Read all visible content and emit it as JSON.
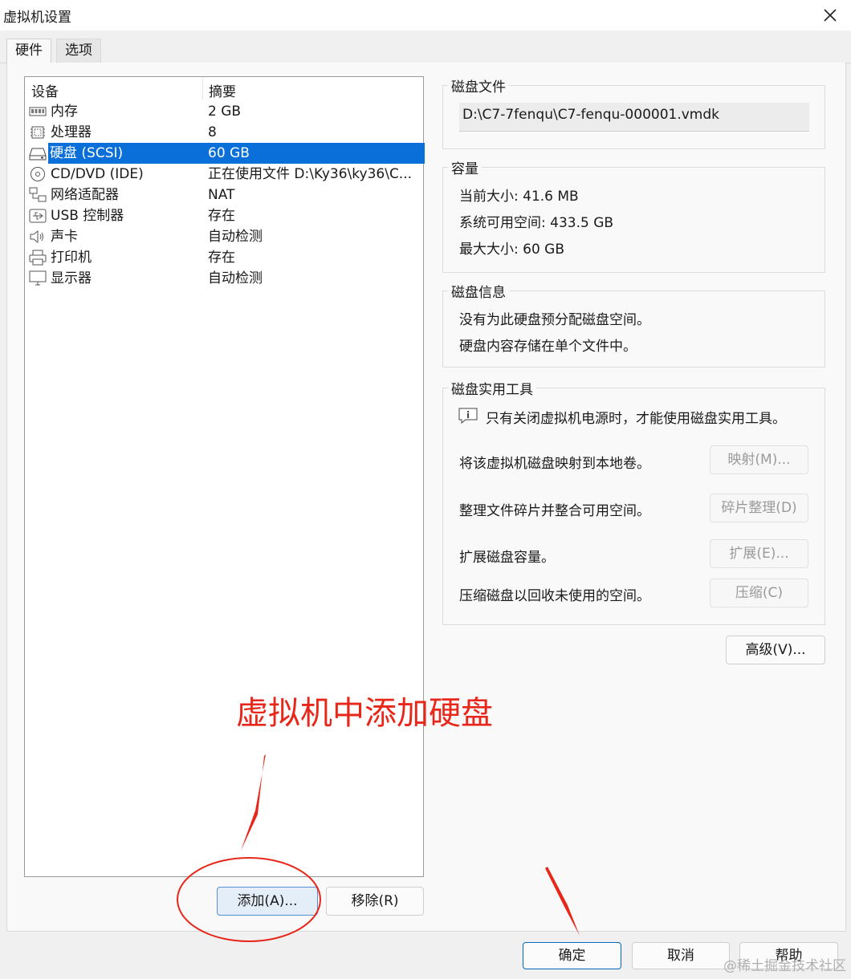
{
  "window": {
    "title": "虚拟机设置"
  },
  "tabs": [
    {
      "label": "硬件"
    },
    {
      "label": "选项"
    }
  ],
  "device_list": {
    "headers": {
      "device": "设备",
      "summary": "摘要"
    },
    "items": [
      {
        "name": "内存",
        "summary": "2 GB",
        "icon": "memory-icon"
      },
      {
        "name": "处理器",
        "summary": "8",
        "icon": "processor-icon"
      },
      {
        "name": "硬盘 (SCSI)",
        "summary": "60 GB",
        "icon": "hard-disk-icon",
        "selected": true
      },
      {
        "name": "CD/DVD (IDE)",
        "summary": "正在使用文件 D:\\Ky36\\ky36\\C...",
        "icon": "cd-dvd-icon"
      },
      {
        "name": "网络适配器",
        "summary": "NAT",
        "icon": "network-adapter-icon"
      },
      {
        "name": "USB 控制器",
        "summary": "存在",
        "icon": "usb-icon"
      },
      {
        "name": "声卡",
        "summary": "自动检测",
        "icon": "sound-card-icon"
      },
      {
        "name": "打印机",
        "summary": "存在",
        "icon": "printer-icon"
      },
      {
        "name": "显示器",
        "summary": "自动检测",
        "icon": "monitor-icon"
      }
    ]
  },
  "disk_file": {
    "title": "磁盘文件",
    "path": "D:\\C7-7fenqu\\C7-fenqu-000001.vmdk"
  },
  "capacity": {
    "title": "容量",
    "current_size": "当前大小: 41.6 MB",
    "available_space": "系统可用空间: 433.5 GB",
    "max_size": "最大大小: 60 GB"
  },
  "disk_info": {
    "title": "磁盘信息",
    "line1": "没有为此硬盘预分配磁盘空间。",
    "line2": "硬盘内容存储在单个文件中。"
  },
  "disk_utilities": {
    "title": "磁盘实用工具",
    "notice": "只有关闭虚拟机电源时，才能使用磁盘实用工具。",
    "map_desc": "将该虚拟机磁盘映射到本地卷。",
    "map_button": "映射(M)...",
    "defrag_desc": "整理文件碎片并整合可用空间。",
    "defrag_button": "碎片整理(D)",
    "expand_desc": "扩展磁盘容量。",
    "expand_button": "扩展(E)...",
    "compact_desc": "压缩磁盘以回收未使用的空间。",
    "compact_button": "压缩(C)"
  },
  "advanced_button": "高级(V)...",
  "add_button": "添加(A)...",
  "remove_button": "移除(R)",
  "footer": {
    "ok": "确定",
    "cancel": "取消",
    "help": "帮助"
  },
  "annotation": {
    "text": "虚拟机中添加硬盘",
    "color": "#e8271b"
  },
  "watermark": "@稀土掘金技术社区",
  "colors": {
    "selection": "#0a6fd8",
    "annotation": "#e8271b",
    "primary_border": "#0067c0"
  }
}
